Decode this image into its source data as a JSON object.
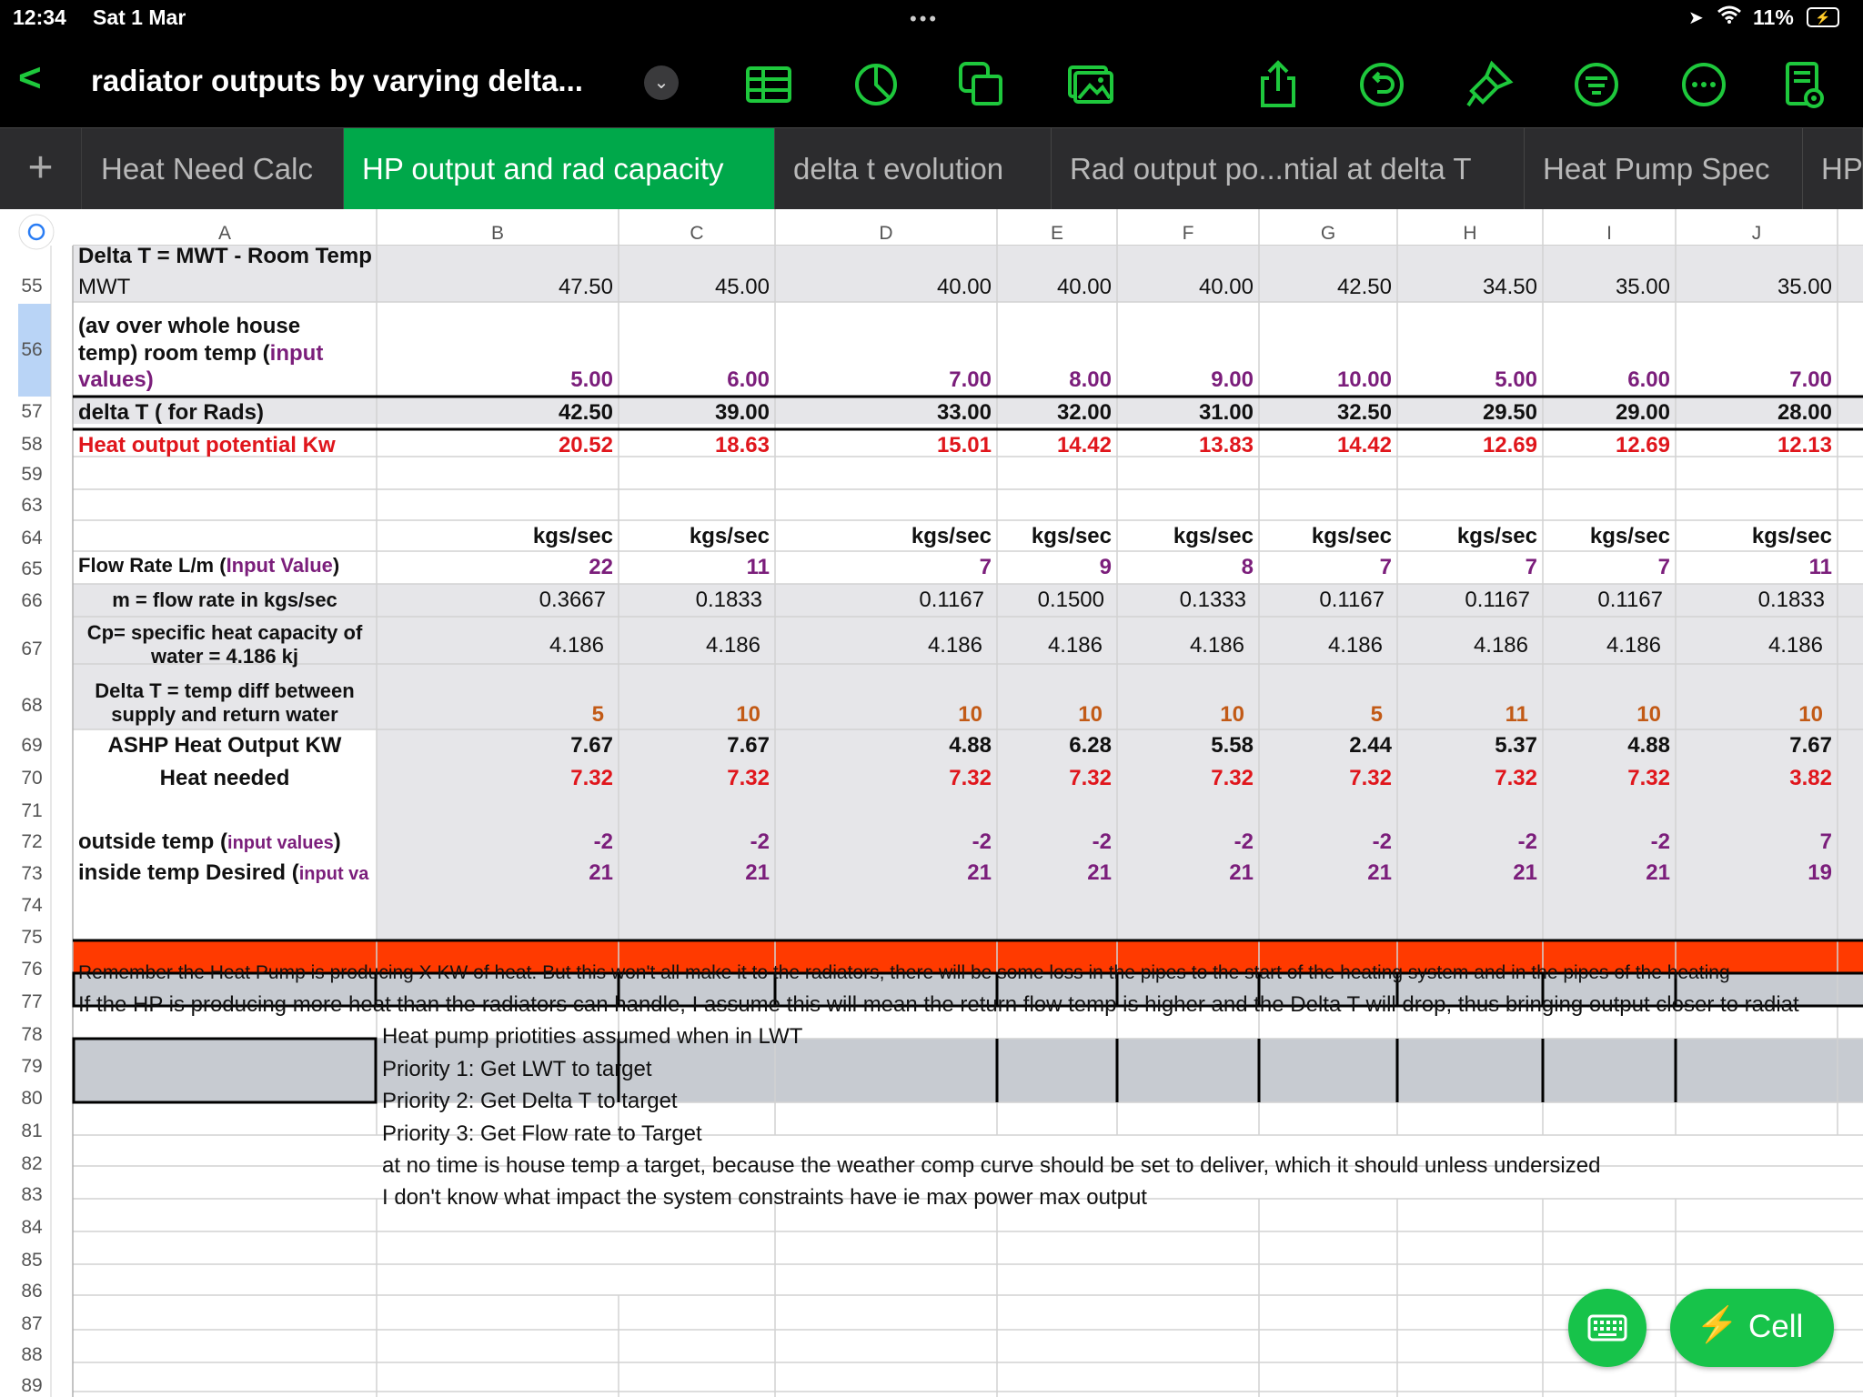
{
  "status_bar": {
    "time": "12:34",
    "date": "Sat 1 Mar",
    "battery": "11%",
    "dots": "•••"
  },
  "toolbar": {
    "back_glyph": "<",
    "title": "radiator outputs by varying delta...",
    "icons": [
      "table-icon",
      "chart-icon",
      "shapes-icon",
      "media-icon",
      "share-icon",
      "undo-icon",
      "format-brush-icon",
      "filter-icon",
      "more-icon",
      "view-options-icon"
    ],
    "accent_color": "#1ec83c"
  },
  "tabs": [
    {
      "label": "Heat Need Calc"
    },
    {
      "label": "HP output and rad capacity"
    },
    {
      "label": "delta  t evolution"
    },
    {
      "label": "Rad output po...ntial at delta T"
    },
    {
      "label": "Heat Pump Spec"
    },
    {
      "label": "HP"
    }
  ],
  "active_tab_color": "#00a84a",
  "grid": {
    "columns": [
      "A",
      "B",
      "C",
      "D",
      "E",
      "F",
      "G",
      "H",
      "I",
      "J"
    ],
    "rows": {
      "r54": {
        "a": "Delta T = MWT - Room Temp"
      },
      "r55": {
        "num": "55",
        "a": "MWT",
        "v": [
          "47.50",
          "45.00",
          "40.00",
          "40.00",
          "40.00",
          "42.50",
          "34.50",
          "35.00",
          "35.00"
        ]
      },
      "r56": {
        "num": "56",
        "a1": "(av over whole house",
        "a2a": "temp) room temp (",
        "a2b": "input",
        "a3": "values)",
        "v": [
          "5.00",
          "6.00",
          "7.00",
          "8.00",
          "9.00",
          "10.00",
          "5.00",
          "6.00",
          "7.00"
        ]
      },
      "r57": {
        "num": "57",
        "a": "delta T ( for Rads)",
        "v": [
          "42.50",
          "39.00",
          "33.00",
          "32.00",
          "31.00",
          "32.50",
          "29.50",
          "29.00",
          "28.00"
        ]
      },
      "r58": {
        "num": "58",
        "a": "Heat output potential  Kw",
        "v": [
          "20.52",
          "18.63",
          "15.01",
          "14.42",
          "13.83",
          "14.42",
          "12.69",
          "12.69",
          "12.13"
        ]
      },
      "r59": {
        "num": "59"
      },
      "r63": {
        "num": "63"
      },
      "r64": {
        "num": "64",
        "v": [
          "kgs/sec",
          "kgs/sec",
          "kgs/sec",
          "kgs/sec",
          "kgs/sec",
          "kgs/sec",
          "kgs/sec",
          "kgs/sec",
          "kgs/sec"
        ]
      },
      "r65": {
        "num": "65",
        "a1": "Flow Rate L/m  (",
        "a2": "Input Value",
        "a3": ")",
        "v": [
          "22",
          "11",
          "7",
          "9",
          "8",
          "7",
          "7",
          "7",
          "11"
        ]
      },
      "r66": {
        "num": "66",
        "a": "m = flow rate in kgs/sec",
        "v": [
          "0.3667",
          "0.1833",
          "0.1167",
          "0.1500",
          "0.1333",
          "0.1167",
          "0.1167",
          "0.1167",
          "0.1833"
        ]
      },
      "r67": {
        "num": "67",
        "a1": "Cp= specific heat capacity of",
        "a2": "water = 4.186 kj",
        "v": [
          "4.186",
          "4.186",
          "4.186",
          "4.186",
          "4.186",
          "4.186",
          "4.186",
          "4.186",
          "4.186"
        ]
      },
      "r68": {
        "num": "68",
        "a1": "Delta T = temp diff between",
        "a2": "supply and return water",
        "v": [
          "5",
          "10",
          "10",
          "10",
          "10",
          "5",
          "11",
          "10",
          "10"
        ]
      },
      "r69": {
        "num": "69",
        "a": "ASHP Heat Output KW",
        "v": [
          "7.67",
          "7.67",
          "4.88",
          "6.28",
          "5.58",
          "2.44",
          "5.37",
          "4.88",
          "7.67"
        ],
        "fill_color": "#ff3a00"
      },
      "r70": {
        "num": "70",
        "a": "Heat needed",
        "v": [
          "7.32",
          "7.32",
          "7.32",
          "7.32",
          "7.32",
          "7.32",
          "7.32",
          "7.32",
          "3.82"
        ]
      },
      "r71": {
        "num": "71"
      },
      "r72": {
        "num": "72",
        "a1": "outside temp (",
        "a2": "input values",
        "a3": ")",
        "v": [
          "-2",
          "-2",
          "-2",
          "-2",
          "-2",
          "-2",
          "-2",
          "-2",
          "7"
        ]
      },
      "r73": {
        "num": "73",
        "a1": "inside temp Desired (",
        "a2": "input va",
        "v": [
          "21",
          "21",
          "21",
          "21",
          "21",
          "21",
          "21",
          "21",
          "19"
        ]
      },
      "r74": {
        "num": "74"
      },
      "r75": {
        "num": "75"
      },
      "r76": {
        "num": "76",
        "text": "Remember the Heat Pump is producing X KW of heat. But this won't all make it to the radiators, there will be some loss in the pipes to the start of the heating system and in the pipes of the heating"
      },
      "r77": {
        "num": "77",
        "text": "If the HP is producing more heat than the radiators can handle, I assume this will mean the return flow temp is higher and the Delta T will drop, thus bringing output closer to radiat"
      },
      "r78": {
        "num": "78",
        "text": "Heat pump priotities assumed when in LWT"
      },
      "r79": {
        "num": "79",
        "text": "Priority 1: Get LWT to target"
      },
      "r80": {
        "num": "80",
        "text": "Priority 2: Get Delta T to target"
      },
      "r81": {
        "num": "81",
        "text": "Priority 3: Get Flow rate to Target"
      },
      "r82": {
        "num": "82",
        "text": "at no time is house temp a target, because the weather comp curve should be set to deliver, which it should unless undersized"
      },
      "r83": {
        "num": "83",
        "text": "I don't know what impact the system constraints have ie max power max output"
      },
      "r84": {
        "num": "84"
      },
      "r85": {
        "num": "85"
      },
      "r86": {
        "num": "86"
      },
      "r87": {
        "num": "87"
      },
      "r88": {
        "num": "88"
      },
      "r89": {
        "num": "89"
      }
    }
  },
  "fab": {
    "cell_label": "Cell",
    "bolt": "⚡"
  }
}
